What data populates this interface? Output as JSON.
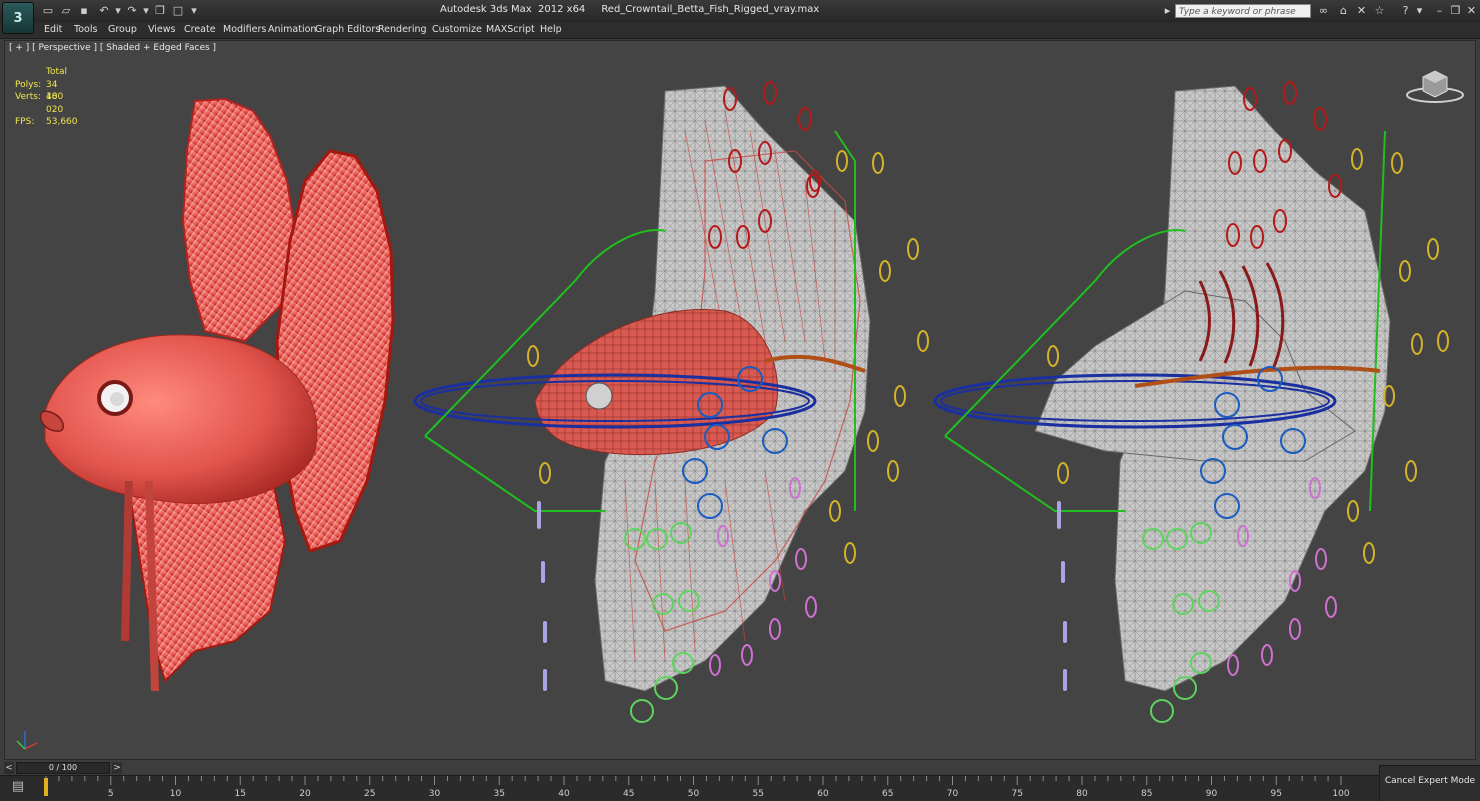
{
  "app": {
    "title": "Autodesk 3ds Max  2012 x64",
    "file": "Red_Crowntail_Betta_Fish_Rigged_vray.max",
    "search_placeholder": "Type a keyword or phrase"
  },
  "quick_access_icons": [
    "new-file-icon",
    "open-file-icon",
    "save-icon",
    "undo-icon",
    "undo-dropdown-icon",
    "redo-icon",
    "redo-dropdown-icon",
    "hold-icon",
    "maximize-icon",
    "customize-dropdown-icon"
  ],
  "search_tools": [
    "binoculars-icon",
    "communication-center-icon",
    "tools-icon",
    "favorites-icon",
    "help-icon"
  ],
  "menu": [
    "Edit",
    "Tools",
    "Group",
    "Views",
    "Create",
    "Modifiers",
    "Animation",
    "Graph Editors",
    "Rendering",
    "Customize",
    "MAXScript",
    "Help"
  ],
  "viewport": {
    "label": "[ + ] [ Perspective ] [ Shaded + Edged Faces ]"
  },
  "stats": {
    "header": "Total",
    "polys_label": "Polys:",
    "polys": "34 400",
    "verts_label": "Verts:",
    "verts": "18 020",
    "fps_label": "FPS:",
    "fps": "53,660"
  },
  "time_slider": {
    "frame": "0 / 100",
    "prev": "<",
    "next": ">"
  },
  "trackbar": {
    "ticks": [
      "5",
      "10",
      "15",
      "20",
      "25",
      "30",
      "35",
      "40",
      "45",
      "50",
      "55",
      "60",
      "65",
      "70",
      "75",
      "80",
      "85",
      "90",
      "95",
      "100"
    ]
  },
  "cancel_expert": "Cancel Expert Mode",
  "colors": {
    "viewport_bg": "#444444",
    "fish_red": "#e2554d",
    "rig_green": "#1fbf1f",
    "rig_blue": "#1a2fa0",
    "rig_yellow": "#d4b22a",
    "rig_red": "#b51a1a",
    "stats_yellow": "#f2e64c"
  }
}
